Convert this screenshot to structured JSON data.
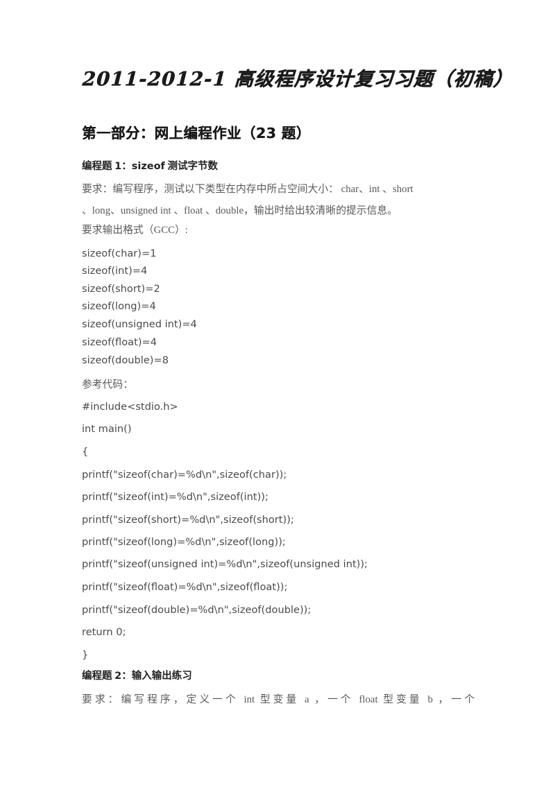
{
  "document": {
    "title": "2011-2012-1 高级程序设计复习习题（初稿）",
    "section_heading": "第一部分：网上编程作业（23 题）",
    "page_background": "#ffffff",
    "body_text_color": "#5a5a5a",
    "heading_color": "#181818"
  },
  "problems": [
    {
      "heading_cjk_prefix": "编程题 ",
      "heading_number": "1",
      "heading_sep": "：",
      "heading_latin": "sizeof",
      "heading_cjk_suffix": " 测试字节数",
      "requirement_label": "要求：",
      "requirement_body_line1": "编写程序，测试以下类型在内存中所占空间大小： char、int 、short",
      "requirement_body_line2": "、long、unsigned int 、float 、double，输出时给出较清晰的提示信息。",
      "format_label": "要求输出格式（GCC）:",
      "expected_output": [
        "sizeof(char)=1",
        "sizeof(int)=4",
        "sizeof(short)=2",
        "sizeof(long)=4",
        "sizeof(unsigned int)=4",
        "sizeof(float)=4",
        "sizeof(double)=8"
      ],
      "reference_code_label": "参考代码：",
      "reference_code": [
        "#include<stdio.h>",
        "int main()",
        "{",
        "printf(\"sizeof(char)=%d\\n\",sizeof(char));",
        "printf(\"sizeof(int)=%d\\n\",sizeof(int));",
        "printf(\"sizeof(short)=%d\\n\",sizeof(short));",
        "printf(\"sizeof(long)=%d\\n\",sizeof(long));",
        "printf(\"sizeof(unsigned int)=%d\\n\",sizeof(unsigned int));",
        "printf(\"sizeof(float)=%d\\n\",sizeof(float));",
        "printf(\"sizeof(double)=%d\\n\",sizeof(double));",
        "return 0;",
        "}"
      ]
    },
    {
      "heading_cjk_prefix": "编程题 ",
      "heading_number": "2",
      "heading_sep": "：",
      "heading_latin": "",
      "heading_cjk_suffix": "输入输出练习",
      "requirement_line": "要求：编写程序，定义一个 int 型变量 a ，一个 float 型变量 b ，一个"
    }
  ]
}
